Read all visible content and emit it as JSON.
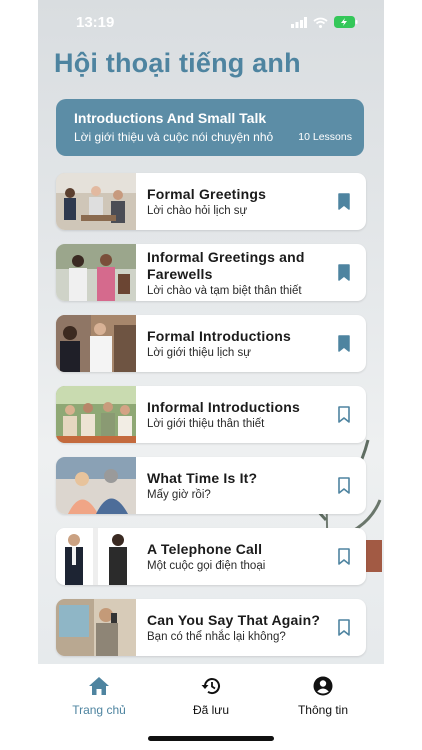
{
  "status_bar": {
    "time": "13:19"
  },
  "header": {
    "title": "Hội thoại tiếng anh"
  },
  "banner": {
    "title": "Introductions And Small Talk",
    "subtitle": "Lời giới thiệu và cuộc nói chuyện nhỏ",
    "count": "10 Lessons"
  },
  "lessons": [
    {
      "title": "Formal Greetings",
      "subtitle": "Lời chào hỏi lịch sự",
      "saved": true
    },
    {
      "title": "Informal Greetings and Farewells",
      "subtitle": "Lời chào và tạm biệt thân thiết",
      "saved": true
    },
    {
      "title": "Formal Introductions",
      "subtitle": "Lời giới thiệu lịch sự",
      "saved": true
    },
    {
      "title": "Informal Introductions",
      "subtitle": "Lời giới thiệu thân thiết",
      "saved": false
    },
    {
      "title": "What Time Is It?",
      "subtitle": "Mấy giờ rồi?",
      "saved": false
    },
    {
      "title": "A Telephone Call",
      "subtitle": "Một cuộc gọi điện thoại",
      "saved": false
    },
    {
      "title": "Can You Say That Again?",
      "subtitle": "Bạn có thể nhắc lại không?",
      "saved": false
    }
  ],
  "nav": {
    "home": "Trang chủ",
    "saved": "Đã lưu",
    "info": "Thông tin"
  },
  "colors": {
    "accent": "#4e84a0",
    "banner": "#5c8da6",
    "nav_active": "#4e84a0",
    "nav_inactive": "#111111"
  }
}
